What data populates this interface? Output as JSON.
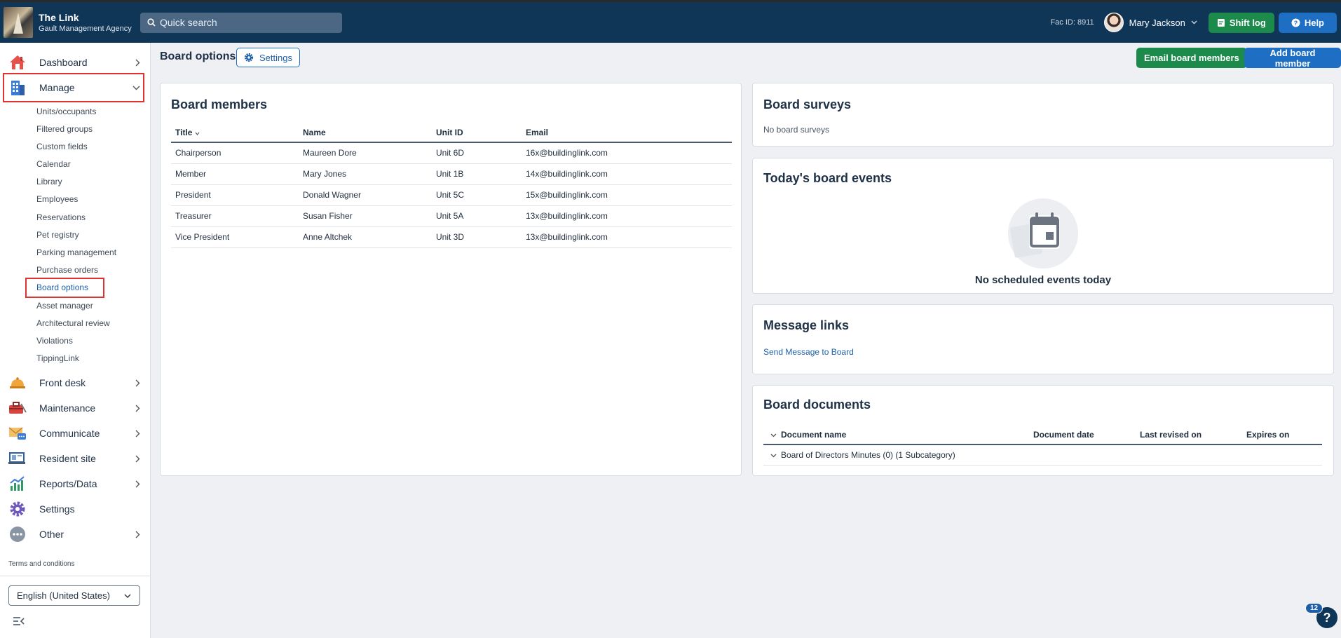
{
  "app": {
    "title": "The Link",
    "subtitle": "Gault Management Agency",
    "search_placeholder": "Quick search",
    "fac_id": "Fac ID: 8911",
    "user_name": "Mary Jackson",
    "shift_log_label": "Shift log",
    "help_label": "Help"
  },
  "sidebar": {
    "items": [
      {
        "label": "Dashboard",
        "icon": "house-icon"
      },
      {
        "label": "Manage",
        "icon": "building-icon"
      },
      {
        "label": "Front desk",
        "icon": "bell-icon"
      },
      {
        "label": "Maintenance",
        "icon": "toolbox-icon"
      },
      {
        "label": "Communicate",
        "icon": "envelope-icon"
      },
      {
        "label": "Resident site",
        "icon": "monitor-icon"
      },
      {
        "label": "Reports/Data",
        "icon": "chart-icon"
      },
      {
        "label": "Settings",
        "icon": "gear-icon"
      },
      {
        "label": "Other",
        "icon": "more-icon"
      }
    ],
    "manage_sub": [
      "Units/occupants",
      "Filtered groups",
      "Custom fields",
      "Calendar",
      "Library",
      "Employees",
      "Reservations",
      "Pet registry",
      "Parking management",
      "Purchase orders",
      "Board options",
      "Asset manager",
      "Architectural review",
      "Violations",
      "TippingLink"
    ],
    "terms": "Terms and conditions",
    "language": "English (United States)"
  },
  "page": {
    "title": "Board options",
    "settings_label": "Settings",
    "email_members_label": "Email board members",
    "add_member_label": "Add board member"
  },
  "board_members": {
    "title": "Board members",
    "columns": [
      "Title",
      "Name",
      "Unit ID",
      "Email"
    ],
    "rows": [
      [
        "Chairperson",
        "Maureen Dore",
        "Unit 6D",
        "16x@buildinglink.com"
      ],
      [
        "Member",
        "Mary Jones",
        "Unit 1B",
        "14x@buildinglink.com"
      ],
      [
        "President",
        "Donald Wagner",
        "Unit 5C",
        "15x@buildinglink.com"
      ],
      [
        "Treasurer",
        "Susan Fisher",
        "Unit 5A",
        "13x@buildinglink.com"
      ],
      [
        "Vice President",
        "Anne Altchek",
        "Unit 3D",
        "13x@buildinglink.com"
      ]
    ]
  },
  "surveys": {
    "title": "Board surveys",
    "empty": "No board surveys"
  },
  "events": {
    "title": "Today's board events",
    "empty": "No scheduled events today"
  },
  "message_links": {
    "title": "Message links",
    "link": "Send Message to Board"
  },
  "documents": {
    "title": "Board documents",
    "columns": [
      "Document name",
      "Document date",
      "Last revised on",
      "Expires on"
    ],
    "rows": [
      "Board of Directors Minutes (0) (1 Subcategory)"
    ]
  },
  "notifications": {
    "count": "12",
    "help_glyph": "?"
  }
}
